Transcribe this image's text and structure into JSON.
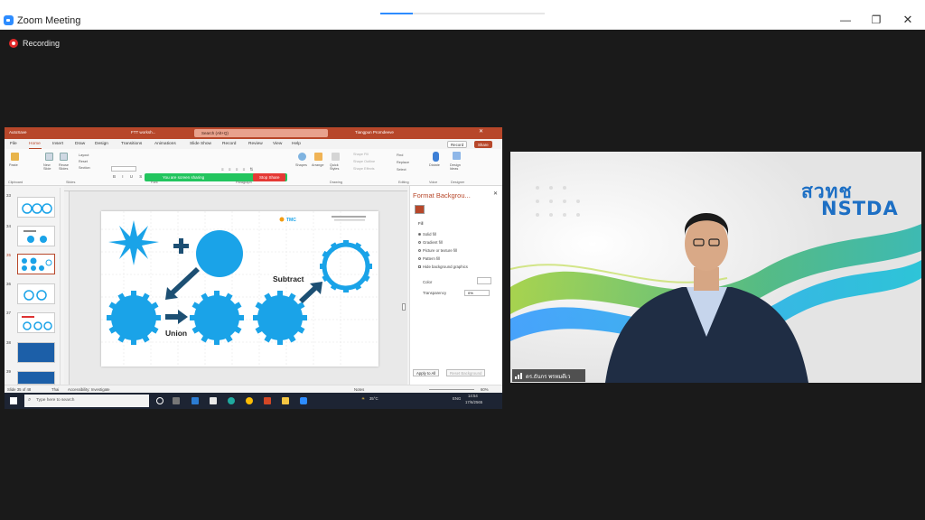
{
  "window": {
    "title": "Zoom Meeting",
    "progress": 0.2
  },
  "controls": {
    "minimize": "—",
    "restore": "❐",
    "close": "✕"
  },
  "recording": {
    "label": "Recording"
  },
  "shared_screen": {
    "titlebar": {
      "autosave": "AutoSave",
      "file_name": "FTT worksh...",
      "search": "Search (Alt+Q)",
      "user": "Tiangpun Promdeeve"
    },
    "menus": [
      "File",
      "Home",
      "Insert",
      "Draw",
      "Design",
      "Transitions",
      "Animations",
      "Slide Show",
      "Record",
      "Review",
      "View",
      "Help"
    ],
    "record_btn": "Record",
    "share_btn": "Share",
    "share_notice": "You are screen sharing",
    "stop_share": "Stop Share",
    "ribbon_groups": [
      "Clipboard",
      "Slides",
      "Font",
      "Paragraph",
      "Drawing",
      "Editing",
      "Voice",
      "Designer"
    ],
    "ribbon_labels": {
      "paste": "Paste",
      "new_slide": "New Slide",
      "reuse": "Reuse Slides",
      "layout": "Layout",
      "reset": "Reset",
      "section": "Section",
      "shapes": "Shapes",
      "arrange": "Arrange",
      "quick_styles": "Quick Styles",
      "shape_fill": "Shape Fill",
      "shape_outline": "Shape Outline",
      "shape_effects": "Shape Effects",
      "find": "Find",
      "replace": "Replace",
      "select": "Select",
      "dictate": "Dictate",
      "design_ideas": "Design Ideas"
    },
    "slide_numbers": [
      "33",
      "34",
      "35",
      "36",
      "37",
      "38",
      "39"
    ],
    "slide": {
      "subtract_label": "Subtract",
      "union_label": "Union",
      "logo_text": "TMC"
    },
    "format_pane": {
      "title": "Format Backgrou...",
      "section": "Fill",
      "options": [
        "Solid fill",
        "Gradient fill",
        "Picture or texture fill",
        "Pattern fill",
        "Hide background graphics"
      ],
      "color_label": "Color",
      "transparency_label": "Transparency",
      "transparency_value": "0%",
      "apply_all": "Apply to All",
      "reset_bg": "Reset Background"
    },
    "status": {
      "slide": "Slide 35 of 48",
      "lang": "Thai",
      "accessibility": "Accessibility: Investigate",
      "notes": "Notes",
      "zoom": "60%"
    },
    "taskbar": {
      "search": "Type here to search",
      "weather": "35°C",
      "lang": "ENG",
      "time": "14:54",
      "date": "17/6/2565"
    },
    "colors": {
      "accent": "#b7472a",
      "gear_blue": "#1aa3e8"
    }
  },
  "video": {
    "logo_top": "สวทช",
    "logo_bottom": "NSTDA",
    "participant_name": "ดร.ธันกร พรหมดีเว"
  }
}
